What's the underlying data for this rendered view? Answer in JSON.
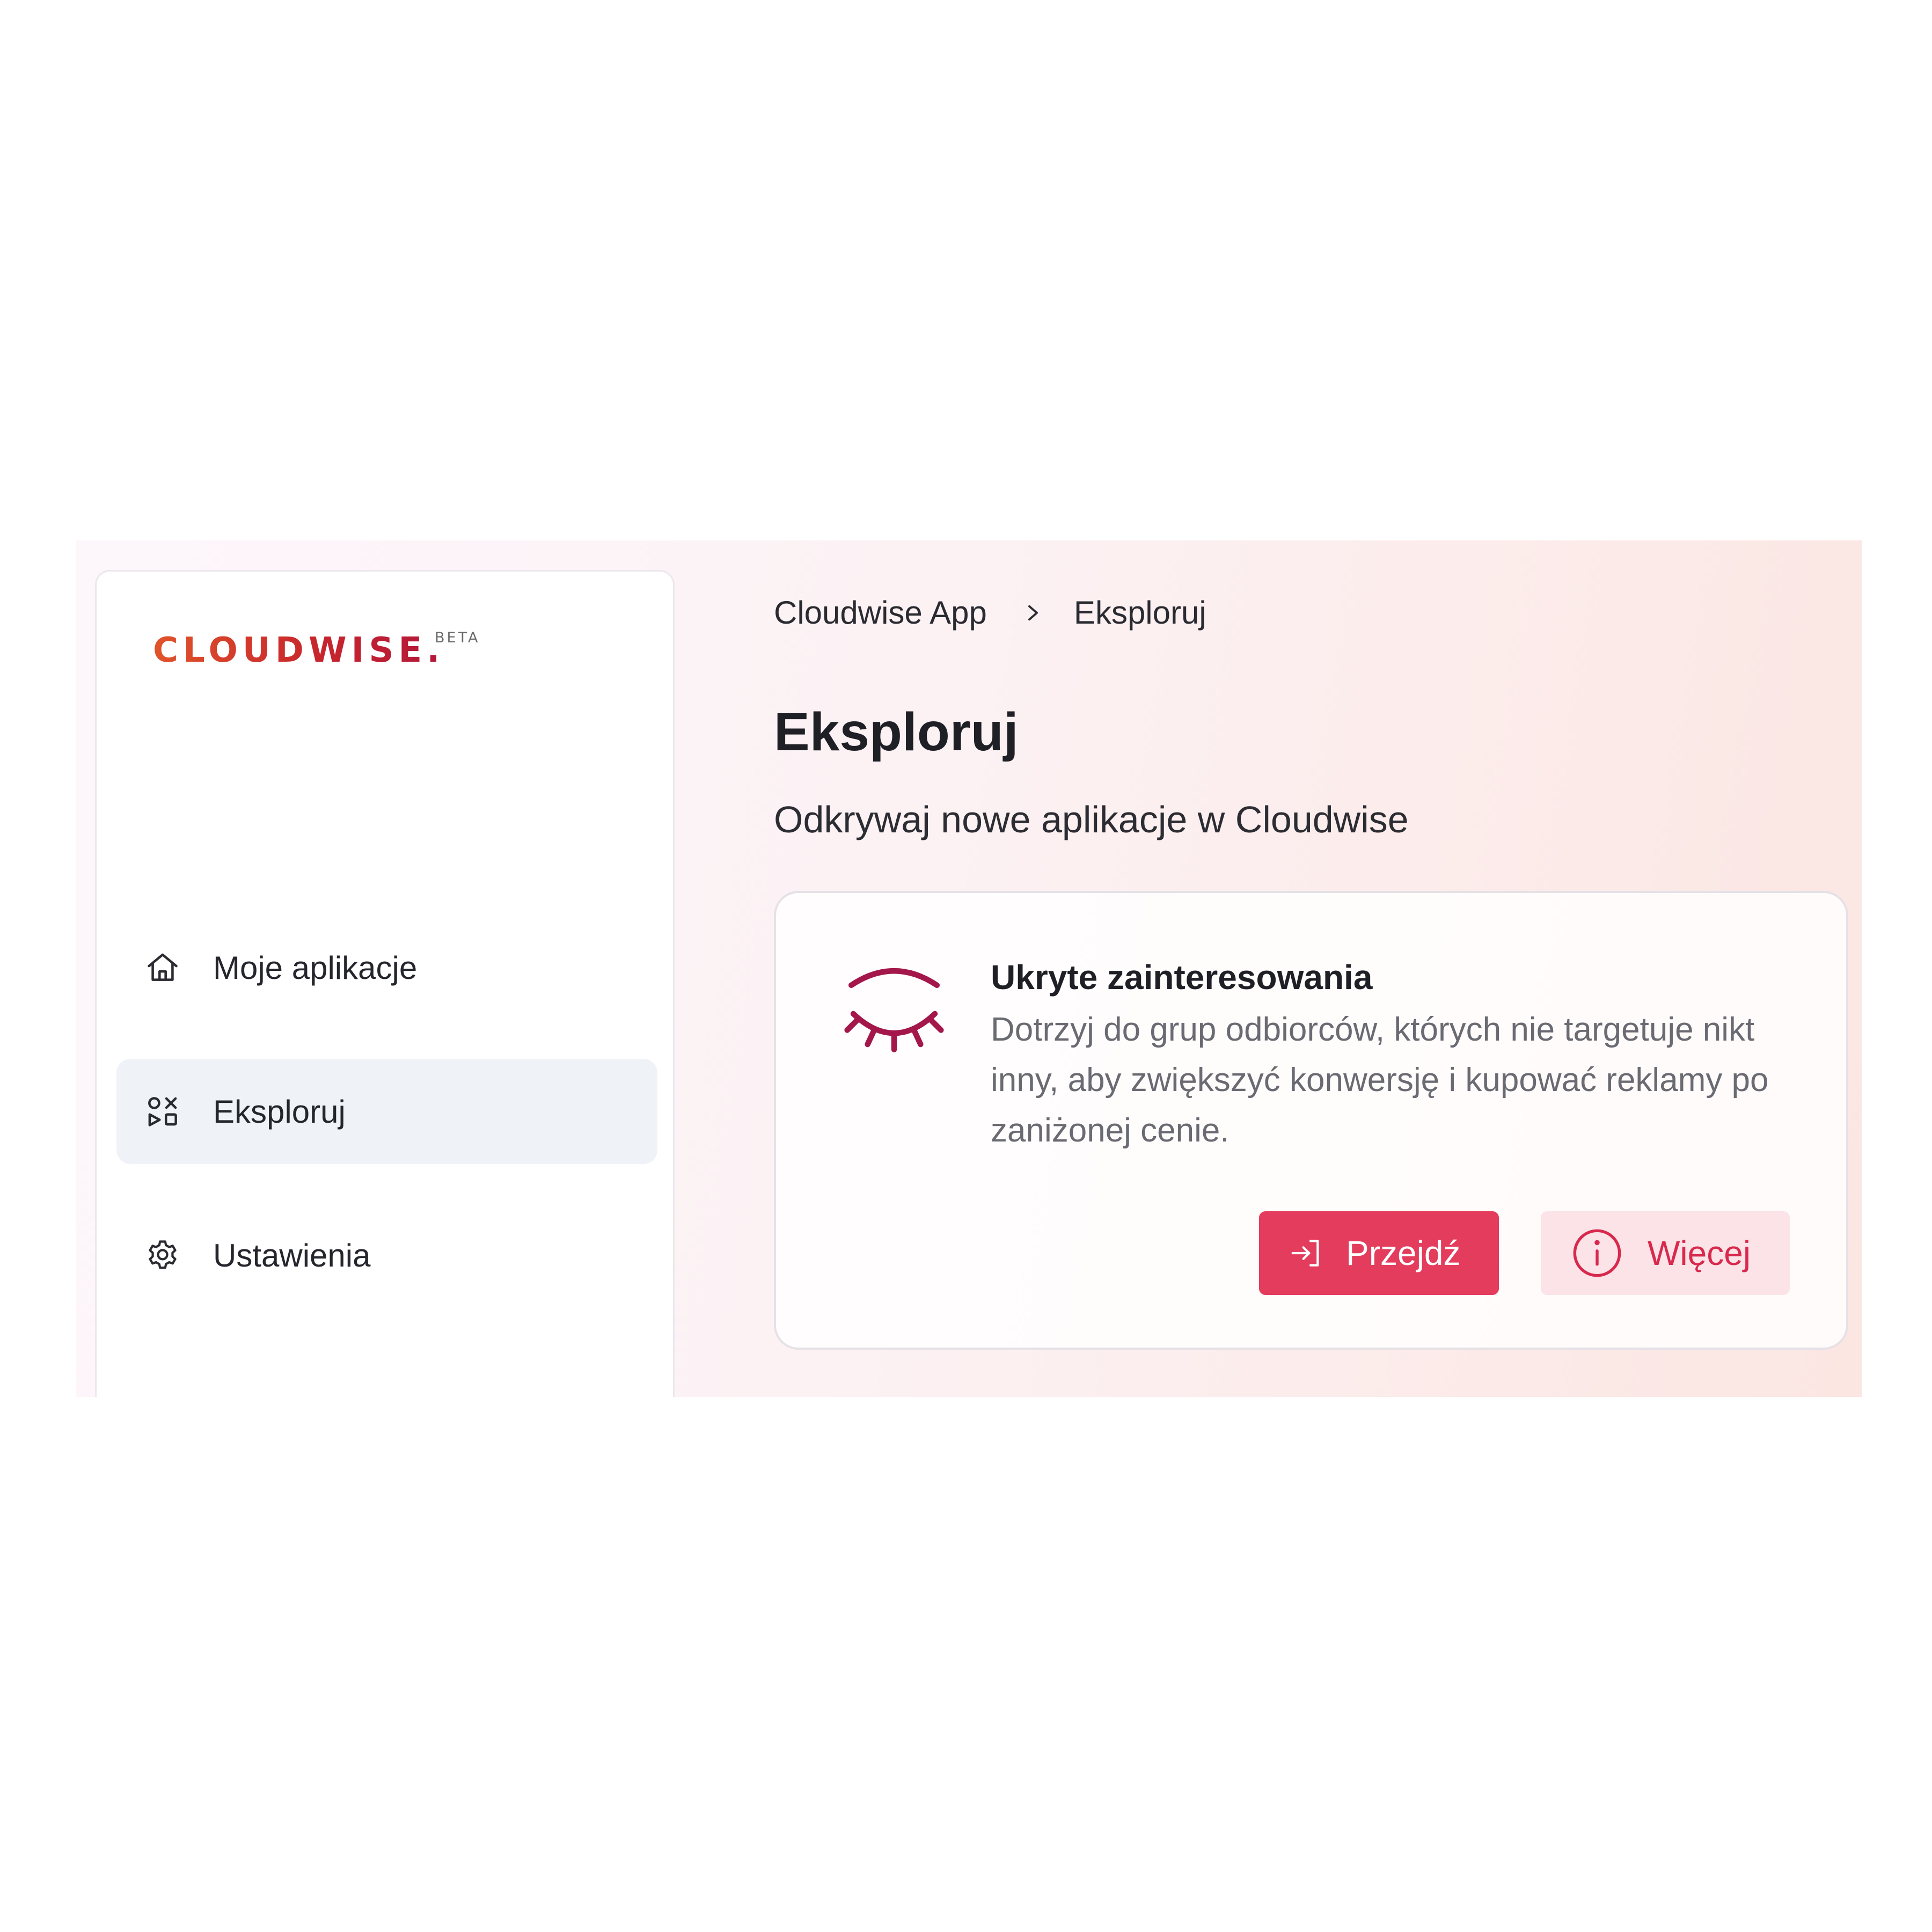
{
  "sidebar": {
    "logo_text": "CLOUDWISE.",
    "logo_badge": "BETA",
    "items": [
      {
        "label": "Moje aplikacje",
        "icon": "home-icon"
      },
      {
        "label": "Eksploruj",
        "icon": "explore-icon",
        "active": true
      },
      {
        "label": "Ustawienia",
        "icon": "gear-icon"
      }
    ]
  },
  "breadcrumb": {
    "items": [
      "Cloudwise App",
      "Eksploruj"
    ]
  },
  "page": {
    "title": "Eksploruj",
    "subtitle": "Odkrywaj nowe aplikacje w Cloudwise"
  },
  "card": {
    "icon": "closed-eye-icon",
    "title": "Ukryte zainteresowania",
    "description": "Dotrzyj do grup odbiorców, których nie targetuje nikt inny, aby zwiększyć konwersję i kupować reklamy po zaniżonej cenie.",
    "primary_button": {
      "label": "Przejdź",
      "icon": "sign-in-icon"
    },
    "secondary_button": {
      "label": "Więcej",
      "icon": "info-icon"
    }
  },
  "colors": {
    "accent": "#e33c5c",
    "accent_soft": "#fbe3e8",
    "icon_dark_red": "#a3174a",
    "active_nav_bg": "#eff3f8"
  }
}
